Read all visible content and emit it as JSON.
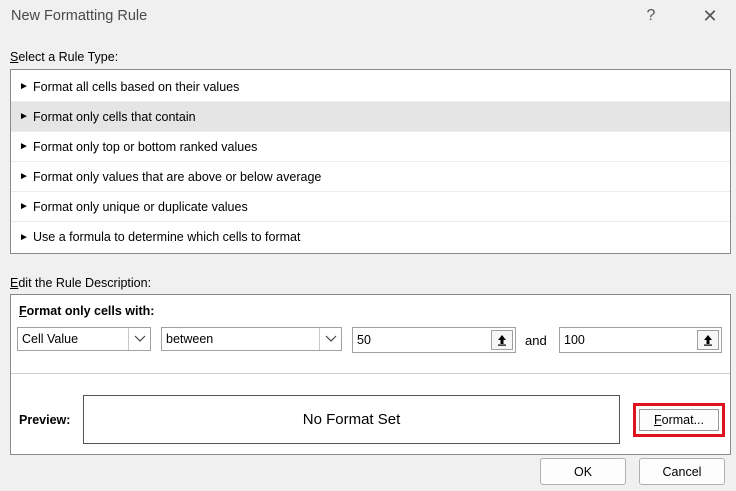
{
  "window": {
    "title": "New Formatting Rule",
    "help_label": "?",
    "close_label": "✕"
  },
  "rule_type": {
    "label_mnemonic": "S",
    "label_rest": "elect a Rule Type:",
    "arrow": "►",
    "items": [
      {
        "label": "Format all cells based on their values"
      },
      {
        "label": "Format only cells that contain"
      },
      {
        "label": "Format only top or bottom ranked values"
      },
      {
        "label": "Format only values that are above or below average"
      },
      {
        "label": "Format only unique or duplicate values"
      },
      {
        "label": "Use a formula to determine which cells to format"
      }
    ],
    "selected_index": 1
  },
  "description": {
    "label_mnemonic": "E",
    "label_rest": "dit the Rule Description:",
    "heading_mnemonic": "F",
    "heading_rest": "ormat only cells with:",
    "condition_type": "Cell Value",
    "operator": "between",
    "value1": "50",
    "and_label": "and",
    "value2": "100"
  },
  "preview": {
    "label": "Preview:",
    "text": "No Format Set"
  },
  "buttons": {
    "format_mnemonic": "F",
    "format_rest": "ormat...",
    "ok": "OK",
    "cancel": "Cancel"
  },
  "colors": {
    "highlight_border": "#e0141e",
    "selected_row": "#e5e5e5"
  }
}
